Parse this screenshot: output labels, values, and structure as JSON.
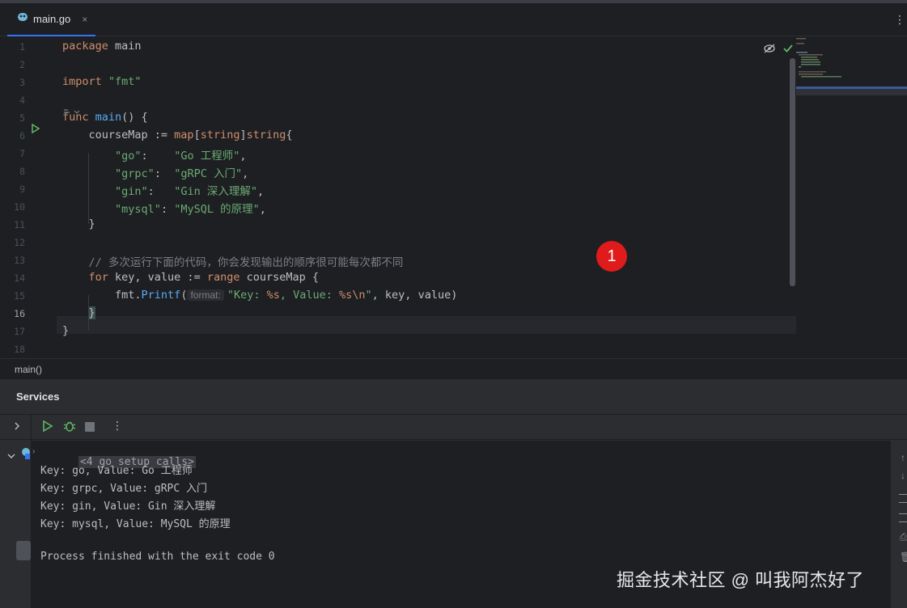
{
  "tab": {
    "filename": "main.go",
    "close": "×"
  },
  "editor": {
    "lines": [
      {
        "num": "1",
        "segments": [
          [
            "kw",
            "package "
          ],
          [
            "",
            "main"
          ]
        ]
      },
      {
        "num": "2",
        "segments": []
      },
      {
        "num": "3",
        "segments": [
          [
            "kw",
            "import "
          ],
          [
            "str",
            "\"fmt\""
          ]
        ]
      },
      {
        "num": "4",
        "segments": []
      },
      {
        "num": "5",
        "segments": [
          [
            "kw",
            "func "
          ],
          [
            "fn",
            "main"
          ],
          [
            "",
            "() {"
          ]
        ]
      },
      {
        "num": "6",
        "segments": [
          [
            "",
            "    courseMap := "
          ],
          [
            "kw",
            "map"
          ],
          [
            "",
            "["
          ],
          [
            "kw",
            "string"
          ],
          [
            "",
            "]"
          ],
          [
            "kw",
            "string"
          ],
          [
            "",
            "{"
          ]
        ]
      },
      {
        "num": "7",
        "segments": [
          [
            "",
            "        "
          ],
          [
            "str",
            "\"go\""
          ],
          [
            "",
            ":    "
          ],
          [
            "str",
            "\"Go 工程师\""
          ],
          [
            "",
            ","
          ]
        ]
      },
      {
        "num": "8",
        "segments": [
          [
            "",
            "        "
          ],
          [
            "str",
            "\"grpc\""
          ],
          [
            "",
            ":  "
          ],
          [
            "str",
            "\"gRPC 入门\""
          ],
          [
            "",
            ","
          ]
        ]
      },
      {
        "num": "9",
        "segments": [
          [
            "",
            "        "
          ],
          [
            "str",
            "\"gin\""
          ],
          [
            "",
            ":   "
          ],
          [
            "str",
            "\"Gin 深入理解\""
          ],
          [
            "",
            ","
          ]
        ]
      },
      {
        "num": "10",
        "segments": [
          [
            "",
            "        "
          ],
          [
            "str",
            "\"mysql\""
          ],
          [
            "",
            ": "
          ],
          [
            "str",
            "\"MySQL 的原理\""
          ],
          [
            "",
            ","
          ]
        ]
      },
      {
        "num": "11",
        "segments": [
          [
            "",
            "    }"
          ]
        ]
      },
      {
        "num": "12",
        "segments": []
      },
      {
        "num": "13",
        "segments": [
          [
            "",
            "    "
          ],
          [
            "cm",
            "// 多次运行下面的代码，你会发现输出的顺序很可能每次都不同"
          ]
        ]
      },
      {
        "num": "14",
        "segments": [
          [
            "",
            "    "
          ],
          [
            "kw",
            "for "
          ],
          [
            "",
            "key, value := "
          ],
          [
            "kw",
            "range "
          ],
          [
            "",
            "courseMap {"
          ]
        ]
      },
      {
        "num": "15",
        "segments": [
          [
            "",
            "        fmt."
          ],
          [
            "fn",
            "Printf"
          ],
          [
            "",
            "("
          ],
          [
            "hint",
            "format:"
          ],
          [
            "str",
            "\"Key: "
          ],
          [
            "fmt",
            "%s"
          ],
          [
            "str",
            ", Value: "
          ],
          [
            "fmt",
            "%s\\n"
          ],
          [
            "str",
            "\""
          ],
          [
            "",
            ", key, value)"
          ]
        ]
      },
      {
        "num": "16",
        "segments": [
          [
            "",
            "    "
          ],
          [
            "match",
            "}"
          ]
        ]
      },
      {
        "num": "17",
        "segments": [
          [
            "",
            "}"
          ]
        ]
      },
      {
        "num": "18",
        "segments": []
      }
    ],
    "active_line": "16"
  },
  "breadcrumb": "main()",
  "services": {
    "title": "Services",
    "console": {
      "setup": "<4 go setup calls>",
      "lines": [
        "Key: go, Value: Go 工程师",
        "Key: grpc, Value: gRPC 入门",
        "Key: gin, Value: Gin 深入理解",
        "Key: mysql, Value: MySQL 的原理",
        "",
        "Process finished with the exit code 0"
      ]
    }
  },
  "badge": "1",
  "watermark": "掘金技术社区 @ 叫我阿杰好了",
  "colors": {
    "keyword": "#cf8e6d",
    "function": "#57aaf7",
    "string": "#6aab73",
    "comment": "#7a7e85",
    "run_green": "#5fb865",
    "badge_red": "#e01b1b"
  }
}
